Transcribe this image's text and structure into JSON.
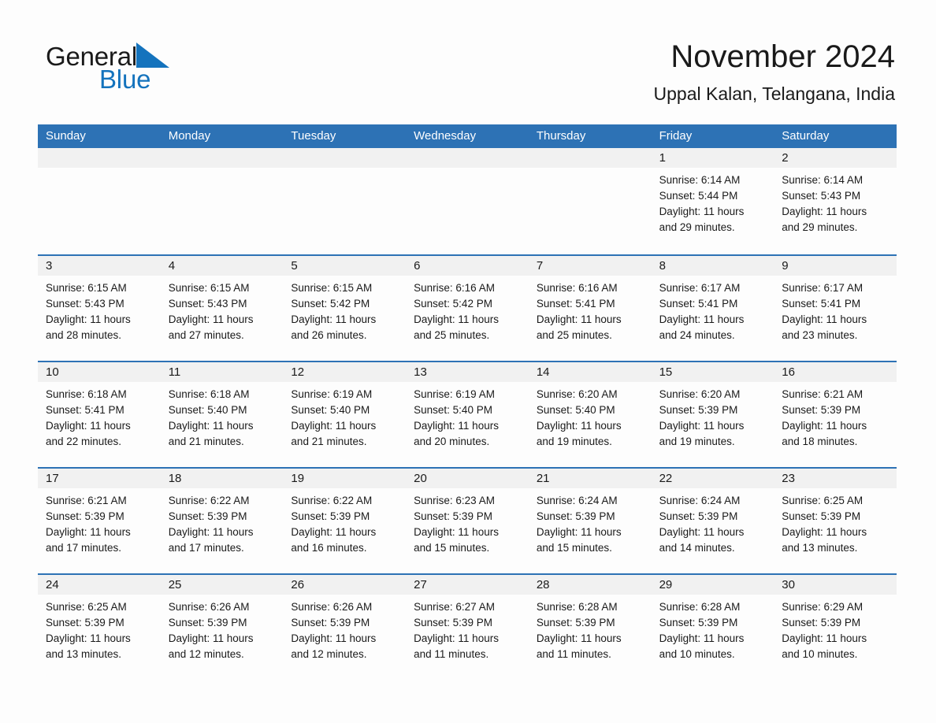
{
  "brand": {
    "name_part1": "General",
    "name_part2": "Blue",
    "triangle_color": "#1473bd",
    "text_color": "#1a1a1a"
  },
  "header": {
    "title": "November 2024",
    "subtitle": "Uppal Kalan, Telangana, India"
  },
  "colors": {
    "header_blue": "#2d72b5",
    "day_band_gray": "#f1f1f1",
    "page_background": "#fdfdfd",
    "text": "#1a1a1a"
  },
  "weekdays": [
    "Sunday",
    "Monday",
    "Tuesday",
    "Wednesday",
    "Thursday",
    "Friday",
    "Saturday"
  ],
  "labels": {
    "sunrise_prefix": "Sunrise:",
    "sunset_prefix": "Sunset:",
    "daylight_prefix": "Daylight:"
  },
  "weeks": [
    [
      {
        "day": "",
        "empty": true
      },
      {
        "day": "",
        "empty": true
      },
      {
        "day": "",
        "empty": true
      },
      {
        "day": "",
        "empty": true
      },
      {
        "day": "",
        "empty": true
      },
      {
        "day": "1",
        "sunrise": "Sunrise: 6:14 AM",
        "sunset": "Sunset: 5:44 PM",
        "daylight_line1": "Daylight: 11 hours",
        "daylight_line2": "and 29 minutes."
      },
      {
        "day": "2",
        "sunrise": "Sunrise: 6:14 AM",
        "sunset": "Sunset: 5:43 PM",
        "daylight_line1": "Daylight: 11 hours",
        "daylight_line2": "and 29 minutes."
      }
    ],
    [
      {
        "day": "3",
        "sunrise": "Sunrise: 6:15 AM",
        "sunset": "Sunset: 5:43 PM",
        "daylight_line1": "Daylight: 11 hours",
        "daylight_line2": "and 28 minutes."
      },
      {
        "day": "4",
        "sunrise": "Sunrise: 6:15 AM",
        "sunset": "Sunset: 5:43 PM",
        "daylight_line1": "Daylight: 11 hours",
        "daylight_line2": "and 27 minutes."
      },
      {
        "day": "5",
        "sunrise": "Sunrise: 6:15 AM",
        "sunset": "Sunset: 5:42 PM",
        "daylight_line1": "Daylight: 11 hours",
        "daylight_line2": "and 26 minutes."
      },
      {
        "day": "6",
        "sunrise": "Sunrise: 6:16 AM",
        "sunset": "Sunset: 5:42 PM",
        "daylight_line1": "Daylight: 11 hours",
        "daylight_line2": "and 25 minutes."
      },
      {
        "day": "7",
        "sunrise": "Sunrise: 6:16 AM",
        "sunset": "Sunset: 5:41 PM",
        "daylight_line1": "Daylight: 11 hours",
        "daylight_line2": "and 25 minutes."
      },
      {
        "day": "8",
        "sunrise": "Sunrise: 6:17 AM",
        "sunset": "Sunset: 5:41 PM",
        "daylight_line1": "Daylight: 11 hours",
        "daylight_line2": "and 24 minutes."
      },
      {
        "day": "9",
        "sunrise": "Sunrise: 6:17 AM",
        "sunset": "Sunset: 5:41 PM",
        "daylight_line1": "Daylight: 11 hours",
        "daylight_line2": "and 23 minutes."
      }
    ],
    [
      {
        "day": "10",
        "sunrise": "Sunrise: 6:18 AM",
        "sunset": "Sunset: 5:41 PM",
        "daylight_line1": "Daylight: 11 hours",
        "daylight_line2": "and 22 minutes."
      },
      {
        "day": "11",
        "sunrise": "Sunrise: 6:18 AM",
        "sunset": "Sunset: 5:40 PM",
        "daylight_line1": "Daylight: 11 hours",
        "daylight_line2": "and 21 minutes."
      },
      {
        "day": "12",
        "sunrise": "Sunrise: 6:19 AM",
        "sunset": "Sunset: 5:40 PM",
        "daylight_line1": "Daylight: 11 hours",
        "daylight_line2": "and 21 minutes."
      },
      {
        "day": "13",
        "sunrise": "Sunrise: 6:19 AM",
        "sunset": "Sunset: 5:40 PM",
        "daylight_line1": "Daylight: 11 hours",
        "daylight_line2": "and 20 minutes."
      },
      {
        "day": "14",
        "sunrise": "Sunrise: 6:20 AM",
        "sunset": "Sunset: 5:40 PM",
        "daylight_line1": "Daylight: 11 hours",
        "daylight_line2": "and 19 minutes."
      },
      {
        "day": "15",
        "sunrise": "Sunrise: 6:20 AM",
        "sunset": "Sunset: 5:39 PM",
        "daylight_line1": "Daylight: 11 hours",
        "daylight_line2": "and 19 minutes."
      },
      {
        "day": "16",
        "sunrise": "Sunrise: 6:21 AM",
        "sunset": "Sunset: 5:39 PM",
        "daylight_line1": "Daylight: 11 hours",
        "daylight_line2": "and 18 minutes."
      }
    ],
    [
      {
        "day": "17",
        "sunrise": "Sunrise: 6:21 AM",
        "sunset": "Sunset: 5:39 PM",
        "daylight_line1": "Daylight: 11 hours",
        "daylight_line2": "and 17 minutes."
      },
      {
        "day": "18",
        "sunrise": "Sunrise: 6:22 AM",
        "sunset": "Sunset: 5:39 PM",
        "daylight_line1": "Daylight: 11 hours",
        "daylight_line2": "and 17 minutes."
      },
      {
        "day": "19",
        "sunrise": "Sunrise: 6:22 AM",
        "sunset": "Sunset: 5:39 PM",
        "daylight_line1": "Daylight: 11 hours",
        "daylight_line2": "and 16 minutes."
      },
      {
        "day": "20",
        "sunrise": "Sunrise: 6:23 AM",
        "sunset": "Sunset: 5:39 PM",
        "daylight_line1": "Daylight: 11 hours",
        "daylight_line2": "and 15 minutes."
      },
      {
        "day": "21",
        "sunrise": "Sunrise: 6:24 AM",
        "sunset": "Sunset: 5:39 PM",
        "daylight_line1": "Daylight: 11 hours",
        "daylight_line2": "and 15 minutes."
      },
      {
        "day": "22",
        "sunrise": "Sunrise: 6:24 AM",
        "sunset": "Sunset: 5:39 PM",
        "daylight_line1": "Daylight: 11 hours",
        "daylight_line2": "and 14 minutes."
      },
      {
        "day": "23",
        "sunrise": "Sunrise: 6:25 AM",
        "sunset": "Sunset: 5:39 PM",
        "daylight_line1": "Daylight: 11 hours",
        "daylight_line2": "and 13 minutes."
      }
    ],
    [
      {
        "day": "24",
        "sunrise": "Sunrise: 6:25 AM",
        "sunset": "Sunset: 5:39 PM",
        "daylight_line1": "Daylight: 11 hours",
        "daylight_line2": "and 13 minutes."
      },
      {
        "day": "25",
        "sunrise": "Sunrise: 6:26 AM",
        "sunset": "Sunset: 5:39 PM",
        "daylight_line1": "Daylight: 11 hours",
        "daylight_line2": "and 12 minutes."
      },
      {
        "day": "26",
        "sunrise": "Sunrise: 6:26 AM",
        "sunset": "Sunset: 5:39 PM",
        "daylight_line1": "Daylight: 11 hours",
        "daylight_line2": "and 12 minutes."
      },
      {
        "day": "27",
        "sunrise": "Sunrise: 6:27 AM",
        "sunset": "Sunset: 5:39 PM",
        "daylight_line1": "Daylight: 11 hours",
        "daylight_line2": "and 11 minutes."
      },
      {
        "day": "28",
        "sunrise": "Sunrise: 6:28 AM",
        "sunset": "Sunset: 5:39 PM",
        "daylight_line1": "Daylight: 11 hours",
        "daylight_line2": "and 11 minutes."
      },
      {
        "day": "29",
        "sunrise": "Sunrise: 6:28 AM",
        "sunset": "Sunset: 5:39 PM",
        "daylight_line1": "Daylight: 11 hours",
        "daylight_line2": "and 10 minutes."
      },
      {
        "day": "30",
        "sunrise": "Sunrise: 6:29 AM",
        "sunset": "Sunset: 5:39 PM",
        "daylight_line1": "Daylight: 11 hours",
        "daylight_line2": "and 10 minutes."
      }
    ]
  ]
}
